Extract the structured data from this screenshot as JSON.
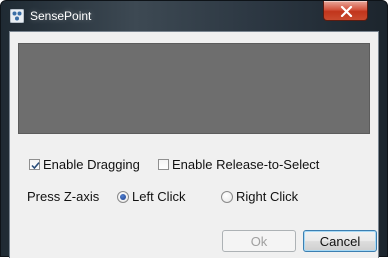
{
  "window": {
    "title": "SensePoint",
    "icon": "sensepoint-app-icon",
    "close_icon": "close-x-icon",
    "close_color": "#c7432a"
  },
  "canvas": {
    "color": "#6e6e6e"
  },
  "options": {
    "enable_dragging": {
      "label": "Enable Dragging",
      "checked": true
    },
    "enable_release_to_select": {
      "label": "Enable Release-to-Select",
      "checked": false
    }
  },
  "press_z_axis": {
    "label": "Press Z-axis",
    "options": [
      {
        "label": "Left Click",
        "selected": true,
        "enabled": true
      },
      {
        "label": "Right Click",
        "selected": false,
        "enabled": true
      }
    ]
  },
  "buttons": {
    "ok": {
      "label": "Ok",
      "enabled": false
    },
    "cancel": {
      "label": "Cancel",
      "enabled": true
    }
  }
}
